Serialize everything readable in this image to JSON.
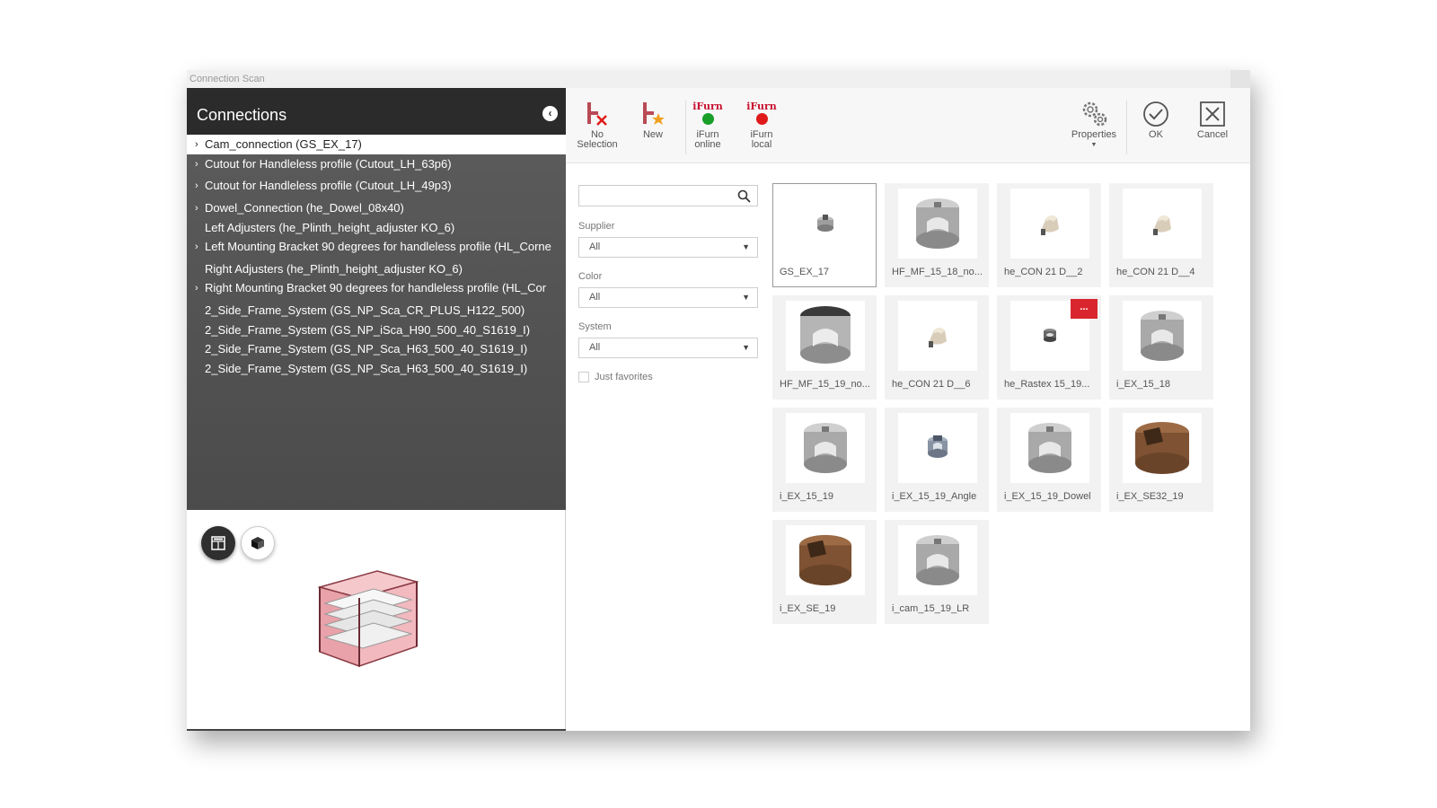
{
  "window": {
    "title": "Connection Scan"
  },
  "left_panel": {
    "title": "Connections",
    "items": [
      {
        "label": "Cam_connection (GS_EX_17)",
        "chevron": "›",
        "selected": true
      },
      {
        "label": "Cutout for Handleless profile (Cutout_LH_63p6)",
        "chevron": "›"
      },
      {
        "label": "Cutout for Handleless profile (Cutout_LH_49p3)",
        "chevron": "›"
      },
      {
        "label": "Dowel_Connection (he_Dowel_08x40)",
        "chevron": "›"
      },
      {
        "label": "Left Adjusters (he_Plinth_height_adjuster KO_6)",
        "chevron": ""
      },
      {
        "label": "Left Mounting Bracket 90 degrees for handleless profile (HL_Corne",
        "chevron": "›"
      },
      {
        "label": "Right Adjusters (he_Plinth_height_adjuster KO_6)",
        "chevron": ""
      },
      {
        "label": "Right Mounting Bracket 90 degrees for handleless profile (HL_Cor",
        "chevron": "›"
      },
      {
        "label": "2_Side_Frame_System (GS_NP_Sca_CR_PLUS_H122_500)",
        "chevron": ""
      },
      {
        "label": "2_Side_Frame_System (GS_NP_iSca_H90_500_40_S1619_I)",
        "chevron": ""
      },
      {
        "label": "2_Side_Frame_System (GS_NP_Sca_H63_500_40_S1619_I)",
        "chevron": ""
      },
      {
        "label": "2_Side_Frame_System (GS_NP_Sca_H63_500_40_S1619_I)",
        "chevron": ""
      }
    ]
  },
  "toolbar": {
    "no_selection": {
      "line1": "No",
      "line2": "Selection"
    },
    "new": "New",
    "ifurn_online": {
      "brand": "iFurn",
      "line1": "iFurn",
      "line2": "online",
      "dot_color": "#1a9e2a"
    },
    "ifurn_local": {
      "brand": "iFurn",
      "line1": "iFurn",
      "line2": "local",
      "dot_color": "#e01a1a"
    },
    "properties": "Properties",
    "ok": "OK",
    "cancel": "Cancel"
  },
  "filters": {
    "search": {
      "value": "",
      "placeholder": ""
    },
    "supplier": {
      "label": "Supplier",
      "value": "All"
    },
    "color": {
      "label": "Color",
      "value": "All"
    },
    "system": {
      "label": "System",
      "value": "All"
    },
    "just_favorites": "Just favorites"
  },
  "items": [
    {
      "name": "GS_EX_17",
      "icon": "small-cam-icon",
      "selected": true
    },
    {
      "name": "HF_MF_15_18_no...",
      "icon": "cam-housing-icon"
    },
    {
      "name": "he_CON 21 D__2",
      "icon": "connector-icon"
    },
    {
      "name": "he_CON 21 D__4",
      "icon": "connector-icon"
    },
    {
      "name": "HF_MF_15_19_no...",
      "icon": "large-cam-housing-icon"
    },
    {
      "name": "he_CON 21 D__6",
      "icon": "connector-icon"
    },
    {
      "name": "he_Rastex 15_19...",
      "icon": "rastex-icon",
      "badge": "..."
    },
    {
      "name": "i_EX_15_18",
      "icon": "cam-housing-icon"
    },
    {
      "name": "i_EX_15_19",
      "icon": "cam-housing-icon"
    },
    {
      "name": "i_EX_15_19_Angle",
      "icon": "angled-cam-icon"
    },
    {
      "name": "i_EX_15_19_Dowel",
      "icon": "cam-housing-icon"
    },
    {
      "name": "i_EX_SE32_19",
      "icon": "brown-cam-icon"
    },
    {
      "name": "i_EX_SE_19",
      "icon": "brown-cam-icon"
    },
    {
      "name": "i_cam_15_19_LR",
      "icon": "cam-housing-icon"
    }
  ],
  "colors": {
    "header_bg": "#2b2b2b",
    "tree_bg": "#555555",
    "badge": "#d9262e"
  }
}
